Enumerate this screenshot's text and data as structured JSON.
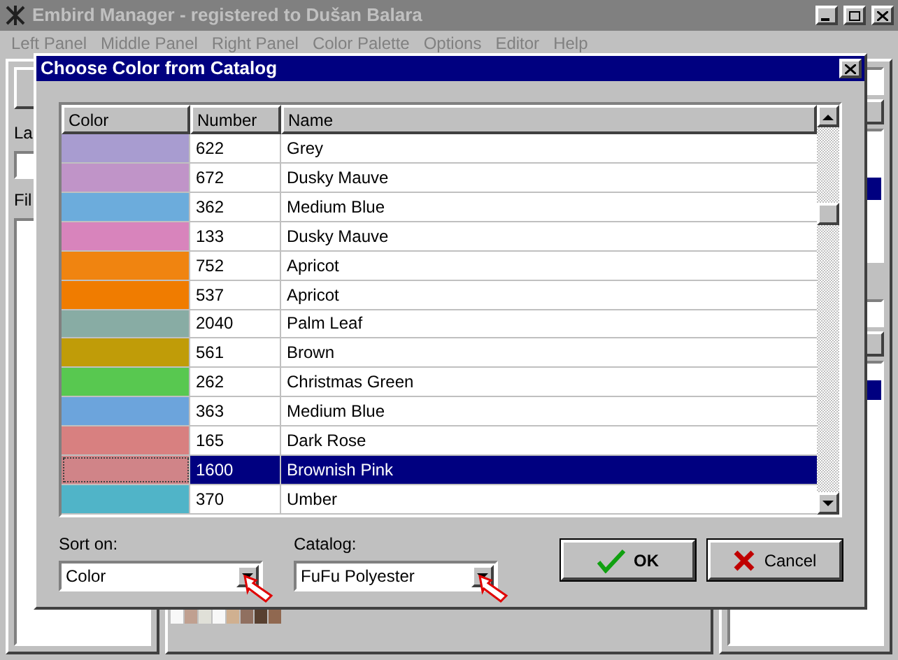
{
  "window": {
    "title": "Embird Manager - registered to Dušan Balara"
  },
  "menu": [
    {
      "label": "Left Panel"
    },
    {
      "label": "Middle Panel"
    },
    {
      "label": "Right Panel"
    },
    {
      "label": "Color Palette"
    },
    {
      "label": "Options"
    },
    {
      "label": "Editor"
    },
    {
      "label": "Help"
    }
  ],
  "left_panel": {
    "label": "La",
    "files_label": "Fil"
  },
  "palette_swatches": [
    {
      "color": "#f8f8f8"
    },
    {
      "color": "#c0a090"
    },
    {
      "color": "#e0e0d8"
    },
    {
      "color": "#f8f8f8"
    },
    {
      "color": "#d0b090"
    },
    {
      "color": "#907060"
    },
    {
      "color": "#584030"
    },
    {
      "color": "#906850"
    }
  ],
  "dialog": {
    "title": "Choose Color from Catalog",
    "columns": [
      "Color",
      "Number",
      "Name"
    ],
    "rows": [
      {
        "color": "#a89cd0",
        "number": "622",
        "name": "Grey",
        "selected": false
      },
      {
        "color": "#c094c8",
        "number": "672",
        "name": "Dusky Mauve",
        "selected": false
      },
      {
        "color": "#6cacdc",
        "number": "362",
        "name": "Medium Blue",
        "selected": false
      },
      {
        "color": "#d884bc",
        "number": "133",
        "name": "Dusky Mauve",
        "selected": false
      },
      {
        "color": "#f08410",
        "number": "752",
        "name": "Apricot",
        "selected": false
      },
      {
        "color": "#f07c00",
        "number": "537",
        "name": "Apricot",
        "selected": false
      },
      {
        "color": "#88aca4",
        "number": "2040",
        "name": "Palm Leaf",
        "selected": false
      },
      {
        "color": "#c09c08",
        "number": "561",
        "name": "Brown",
        "selected": false
      },
      {
        "color": "#58c850",
        "number": "262",
        "name": "Christmas Green",
        "selected": false
      },
      {
        "color": "#6ca4dc",
        "number": "363",
        "name": "Medium Blue",
        "selected": false
      },
      {
        "color": "#d88080",
        "number": "165",
        "name": "Dark Rose",
        "selected": false
      },
      {
        "color": "#d08488",
        "number": "1600",
        "name": "Brownish Pink",
        "selected": true
      },
      {
        "color": "#50b4c8",
        "number": "370",
        "name": "Umber",
        "selected": false
      }
    ],
    "sort_on": {
      "label": "Sort on:",
      "value": "Color"
    },
    "catalog": {
      "label": "Catalog:",
      "value": "FuFu Polyester"
    },
    "buttons": [
      {
        "kind": "ok",
        "label": "OK"
      },
      {
        "kind": "cancel",
        "label": "Cancel"
      }
    ]
  }
}
